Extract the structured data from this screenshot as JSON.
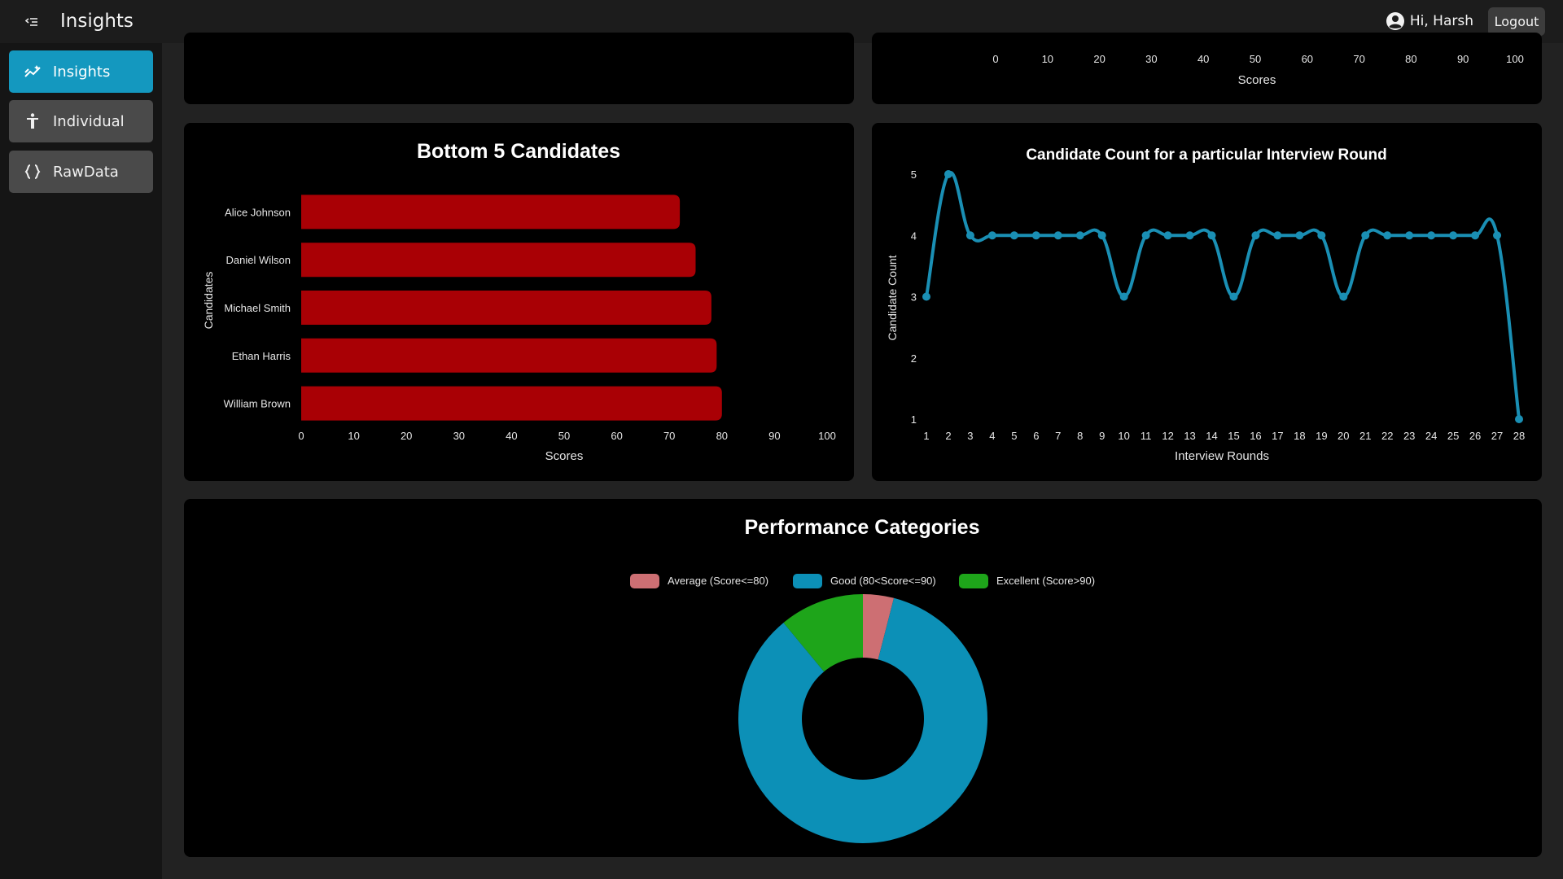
{
  "app": {
    "title": "Insights",
    "greeting": "Hi, Harsh",
    "logout_label": "Logout"
  },
  "sidebar": {
    "items": [
      {
        "label": "Insights",
        "icon": "sparkline-icon",
        "active": true
      },
      {
        "label": "Individual",
        "icon": "person-icon",
        "active": false
      },
      {
        "label": "RawData",
        "icon": "braces-icon",
        "active": false
      }
    ]
  },
  "colors": {
    "accent": "#1498bf",
    "bar": "#a90005",
    "line": "#1a8fb4",
    "average": "#cd6f73",
    "good": "#0c90b7",
    "excellent": "#1ea51a"
  },
  "top_chart_partial": {
    "ticks": [
      "0",
      "10",
      "20",
      "30",
      "40",
      "50",
      "60",
      "70",
      "80",
      "90",
      "100"
    ],
    "xlabel": "Scores"
  },
  "chart_data": [
    {
      "type": "bar",
      "orientation": "horizontal",
      "title": "Bottom 5 Candidates",
      "categories": [
        "Alice Johnson",
        "Daniel Wilson",
        "Michael Smith",
        "Ethan Harris",
        "William Brown"
      ],
      "values": [
        72,
        75,
        78,
        79,
        80
      ],
      "xlabel": "Scores",
      "ylabel": "Candidates",
      "xlim": [
        0,
        100
      ],
      "ticks": [
        "0",
        "10",
        "20",
        "30",
        "40",
        "50",
        "60",
        "70",
        "80",
        "90",
        "100"
      ]
    },
    {
      "type": "line",
      "title": "Candidate Count for a particular Interview Round",
      "x": [
        1,
        2,
        3,
        4,
        5,
        6,
        7,
        8,
        9,
        10,
        11,
        12,
        13,
        14,
        15,
        16,
        17,
        18,
        19,
        20,
        21,
        22,
        23,
        24,
        25,
        26,
        27,
        28
      ],
      "y": [
        3,
        5,
        4,
        4,
        4,
        4,
        4,
        4,
        4,
        3,
        4,
        4,
        4,
        4,
        3,
        4,
        4,
        4,
        4,
        3,
        4,
        4,
        4,
        4,
        4,
        4,
        4,
        1
      ],
      "xlabel": "Interview Rounds",
      "ylabel": "Candidate Count",
      "ylim": [
        1,
        5
      ],
      "yticks": [
        "1",
        "2",
        "3",
        "4",
        "5"
      ]
    },
    {
      "type": "pie",
      "variant": "doughnut",
      "title": "Performance Categories",
      "labels": [
        "Average (Score<=80)",
        "Good (80<Score<=90)",
        "Excellent (Score>90)"
      ],
      "values": [
        4,
        85,
        11
      ],
      "legend": "top"
    }
  ]
}
